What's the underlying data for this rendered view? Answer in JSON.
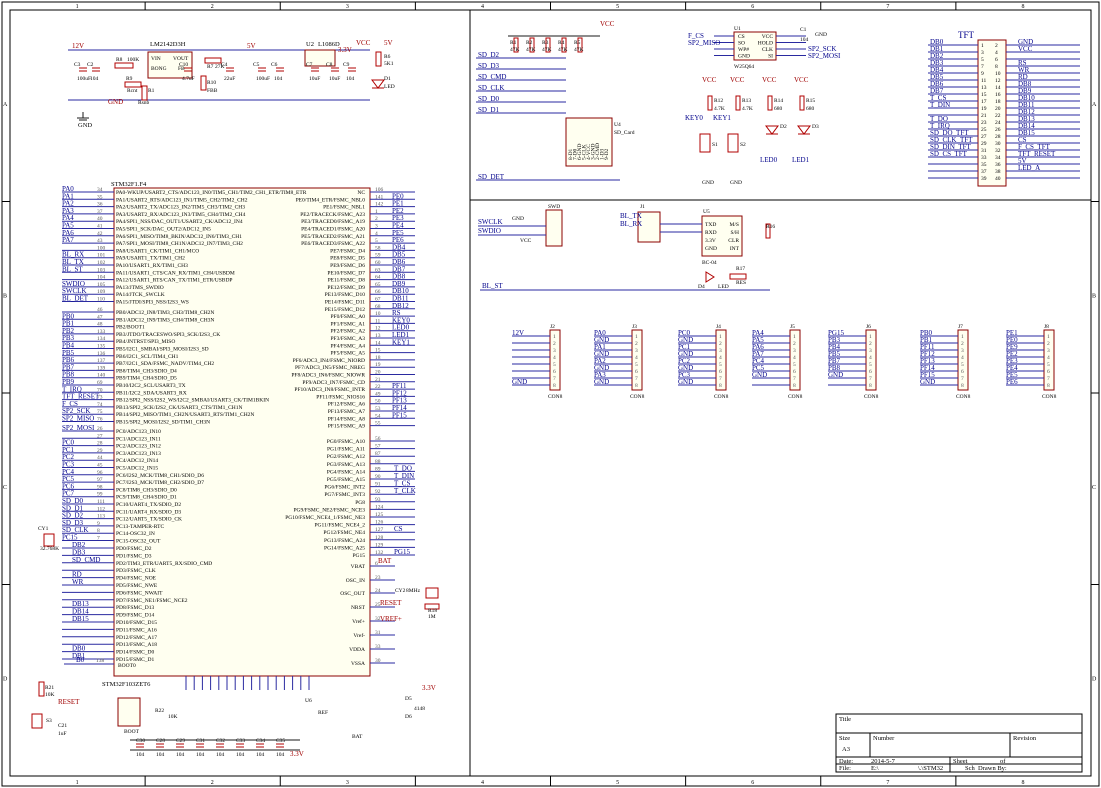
{
  "frame": {
    "cols": [
      "1",
      "2",
      "3",
      "4",
      "5",
      "6",
      "7",
      "8"
    ],
    "rows": [
      "A",
      "B",
      "C",
      "D"
    ]
  },
  "power": {
    "in12v": "12V",
    "v5": "5V",
    "v33": "3.3V",
    "vcc": "VCC",
    "gnd": "GND",
    "regulator": "LM2142D3H",
    "reg_pins": [
      "VIN",
      "VOUT",
      "BONG",
      "FB"
    ],
    "ldo": "L1086D",
    "ldo_label": "U2",
    "c_labels": [
      "C3",
      "C2",
      "C10",
      "C4",
      "C5",
      "C6",
      "C7",
      "C8",
      "C9"
    ],
    "c_values": [
      "100uF",
      "104",
      "4.7uF",
      "22uF",
      "100uF",
      "104",
      "10uF",
      "10uF",
      "104"
    ],
    "r_labels": [
      "R8",
      "R9",
      "R7",
      "R10",
      "R1",
      "R6"
    ],
    "r_values": [
      "100K",
      "Rcnt",
      "Rsnb",
      "27K",
      "FBB",
      "5K1"
    ],
    "u1": "U1",
    "d1": "D1",
    "led": "LED"
  },
  "mcu": {
    "name": "STM32F1.F4",
    "ref": "STM32F103ZET6",
    "left_nets": [
      "PA0",
      "PA1",
      "PA2",
      "PA3",
      "PA4",
      "PA5",
      "PA6",
      "PA7",
      "",
      "BL_RX",
      "BL_TX",
      "BL_ST",
      "",
      "SWDIO",
      "SWCLK",
      "BL_DET",
      "",
      "PB0",
      "PB1",
      "PB2",
      "PB3",
      "PB4",
      "PB5",
      "PB6",
      "PB7",
      "PB8",
      "PB9",
      "T_IRQ",
      "TFT_RESET",
      "F_CS",
      "SP2_SCK",
      "SP2_MISO",
      "SP2_MOSI",
      "",
      "PC0",
      "PC1",
      "PC2",
      "PC3",
      "PC4",
      "PC5",
      "PC6",
      "PC7",
      "SD_D0",
      "SD_D1",
      "SD_D2",
      "SD_D3",
      "SD_CLK",
      "PC15"
    ],
    "left_pins": [
      "34",
      "35",
      "36",
      "37",
      "40",
      "41",
      "42",
      "43",
      "100",
      "101",
      "102",
      "103",
      "104",
      "105",
      "109",
      "110",
      "46",
      "47",
      "48",
      "133",
      "134",
      "135",
      "136",
      "137",
      "139",
      "140",
      "69",
      "70",
      "73",
      "74",
      "75",
      "76",
      "26",
      "27",
      "28",
      "29",
      "44",
      "45",
      "96",
      "97",
      "98",
      "99",
      "111",
      "112",
      "113",
      "9",
      "8",
      "7"
    ],
    "left_fn": [
      "PA0-WKUP/USART2_CTS/ADC123_IN0/TIM5_CH1/TIM2_CH1_ETR/TIM8_ETR",
      "PA1/USART2_RTS/ADC123_IN1/TIM5_CH2/TIM2_CH2",
      "PA2/USART2_TX/ADC123_IN2/TIM5_CH3/TIM2_CH3",
      "PA3/USART2_RX/ADC123_IN3/TIM5_CH4/TIM2_CH4",
      "PA4/SPI1_NSS/DAC_OUT1/USART2_CK/ADC12_IN4",
      "PA5/SPI1_SCK/DAC_OUT2/ADC12_IN5",
      "PA6/SPI1_MISO/TIM8_BKIN/ADC12_IN6/TIM3_CH1",
      "PA7/SPI1_MOSI/TIM8_CH1N/ADC12_IN7/TIM3_CH2",
      "PA8/USART1_CK/TIM1_CH1/MCO",
      "PA9/USART1_TX/TIM1_CH2",
      "PA10/USART1_RX/TIM1_CH3",
      "PA11/USART1_CTS/CAN_RX/TIM1_CH4/USBDM",
      "PA12/USART1_RTS/CAN_TX/TIM1_ETR/USBDP",
      "PA13/JTMS_SWDIO",
      "PA14/JTCK_SWCLK",
      "PA15/JTDI/SPI3_NSS/I2S3_WS",
      "PB0/ADC12_IN8/TIM3_CH3/TIM8_CH2N",
      "PB1/ADC12_IN9/TIM3_CH4/TIM8_CH3N",
      "PB2/BOOT1",
      "PB3/JTDO/TRACESWO/SPI3_SCK/I2S3_CK",
      "PB4/JNTRST/SPI3_MISO",
      "PB5/I2C1_SMBAI/SPI3_MOSI/I2S3_SD",
      "PB6/I2C1_SCL/TIM4_CH1",
      "PB7/I2C1_SDA/FSMC_NADV/TIM4_CH2",
      "PB8/TIM4_CH3/SDIO_D4",
      "PB9/TIM4_CH4/SDIO_D5",
      "PB10/I2C2_SCL/USART3_TX",
      "PB11/I2C2_SDA/USART3_RX",
      "PB12/SPI2_NSS/I2S2_WS/I2C2_SMBAI/USART3_CK/TIM1BKIN",
      "PB13/SPI2_SCK/I2S2_CK/USART3_CTS/TIM1_CH1N",
      "PB14/SPI2_MISO/TIM1_CH2N/USART3_RTS/TIM1_CH2N",
      "PB15/SPI2_MOSI/I2S2_SD/TIM1_CH3N",
      "PC0/ADC123_IN10",
      "PC1/ADC123_IN11",
      "PC2/ADC123_IN12",
      "PC3/ADC123_IN13",
      "PC4/ADC12_IN14",
      "PC5/ADC12_IN15",
      "PC6/I2S2_MCK/TIM8_CH1/SDIO_D6",
      "PC7/I2S3_MCK/TIM8_CH2/SDIO_D7",
      "PC8/TIM8_CH3/SDIO_D0",
      "PC9/TIM8_CH4/SDIO_D1",
      "PC10/UART4_TX/SDIO_D2",
      "PC11/UART4_RX/SDIO_D3",
      "PC12/UART5_TX/SDIO_CK",
      "PC13-TAMPER-RTC",
      "PC14-OSC32_IN",
      "PC15-OSC32_OUT"
    ],
    "right_fn": [
      "NC",
      "PE0/TIM4_ETR/FSMC_NBL0",
      "PE1/FSMC_NBL1",
      "PE2/TRACECK/FSMC_A23",
      "PE3/TRACED0/FSMC_A19",
      "PE4/TRACED1/FSMC_A20",
      "PE5/TRACED2/FSMC_A21",
      "PE6/TRACED3/FSMC_A22",
      "PE7/FSMC_D4",
      "PE8/FSMC_D5",
      "PE9/FSMC_D6",
      "PE10/FSMC_D7",
      "PE11/FSMC_D8",
      "PE12/FSMC_D9",
      "PE13/FSMC_D10",
      "PE14/FSMC_D11",
      "PE15/FSMC_D12",
      "PF0/FSMC_A0",
      "PF1/FSMC_A1",
      "PF2/FSMC_A2",
      "PF3/FSMC_A3",
      "PF4/FSMC_A4",
      "PF5/FSMC_A5",
      "PF6/ADC3_IN4/FSMC_NIORD",
      "PF7/ADC3_IN5/FSMC_NREG",
      "PF8/ADC3_IN6/FSMC_NIOWR",
      "PF9/ADC3_IN7/FSMC_CD",
      "PF10/ADC3_IN8/FSMC_INTR",
      "PF11/FSMC_NIOS16",
      "PF12/FSMC_A6",
      "PF13/FSMC_A7",
      "PF14/FSMC_A8",
      "PF15/FSMC_A9"
    ],
    "right_pins": [
      "106",
      "141",
      "142",
      "1",
      "2",
      "3",
      "4",
      "5",
      "58",
      "59",
      "60",
      "63",
      "64",
      "65",
      "66",
      "67",
      "68",
      "10",
      "11",
      "12",
      "13",
      "14",
      "15",
      "18",
      "19",
      "20",
      "21",
      "22",
      "49",
      "50",
      "53",
      "54",
      "55"
    ],
    "right_nets": [
      "",
      "PE0",
      "PE1",
      "PE2",
      "PE3",
      "PE4",
      "PE5",
      "PE6",
      "DB4",
      "DB5",
      "DB6",
      "DB7",
      "DB8",
      "DB9",
      "DB10",
      "DB11",
      "DB12",
      "RS",
      "KEY0",
      "LED0",
      "LED1",
      "KEY1",
      "",
      "",
      "",
      "",
      "",
      "PF11",
      "PF12",
      "PF13",
      "PF14",
      "PF15",
      ""
    ],
    "g_fn": [
      "PG0/FSMC_A10",
      "PG1/FSMC_A11",
      "PG2/FSMC_A12",
      "PG3/FSMC_A13",
      "PG4/FSMC_A14",
      "PG5/FSMC_A15",
      "PG6/FSMC_INT2",
      "PG7/FSMC_INT3",
      "PG8",
      "PG9/FSMC_NE2/FSMC_NCE3",
      "PG10/FSMC_NCE4_1/FSMC_NE3",
      "PG11/FSMC_NCE4_2",
      "PG12/FSMC_NE4",
      "PG13/FSMC_A24",
      "PG14/FSMC_A25",
      "PG15"
    ],
    "g_pins": [
      "56",
      "57",
      "87",
      "88",
      "89",
      "90",
      "91",
      "92",
      "93",
      "124",
      "125",
      "126",
      "127",
      "128",
      "129",
      "132"
    ],
    "g_nets": [
      "",
      "",
      "",
      "",
      "T_DO",
      "T_DIN",
      "T_CS",
      "T_CLK",
      "",
      "",
      "",
      "",
      "CS",
      "",
      "",
      "PG15"
    ],
    "d_fn": [
      "PD0/FSMC_D2",
      "PD1/FSMC_D3",
      "PD2/TIM3_ETR/UART5_RX/SDIO_CMD",
      "PD3/FSMC_CLK",
      "PD4/FSMC_NOE",
      "PD5/FSMC_NWE",
      "PD6/FSMC_NWAIT",
      "PD7/FSMC_NE1/FSMC_NCE2",
      "PD8/FSMC_D13",
      "PD9/FSMC_D14",
      "PD10/FSMC_D15",
      "PD11/FSMC_A16",
      "PD12/FSMC_A17",
      "PD13/FSMC_A18",
      "PD14/FSMC_D0",
      "PD15/FSMC_D1"
    ],
    "d_nets": [
      "DB2",
      "DB3",
      "SD_CMD",
      "",
      "RD",
      "WR",
      "",
      "",
      "DB13",
      "DB14",
      "DB15",
      "",
      "",
      "",
      "DB0",
      "DB1"
    ],
    "misc_right": [
      "VBAT",
      "OSC_IN",
      "OSC_OUT",
      "NRST",
      "Vref+",
      "Vref-",
      "VDDA",
      "VSSA"
    ],
    "misc_pins": [
      "6",
      "23",
      "24",
      "25",
      "32",
      "31",
      "33",
      "30"
    ],
    "boot": "BOOT0",
    "boot_pin": "138",
    "bat": "BAT",
    "reset": "RESET",
    "vref": "VREF+",
    "b0": "B0"
  },
  "sd": {
    "nets": [
      "SD_D2",
      "SD_D3",
      "SD_CMD",
      "SD_CLK",
      "SD_D0",
      "SD_D1",
      "SD_DET"
    ],
    "res": [
      "R1",
      "R2",
      "R3",
      "R4",
      "R5"
    ],
    "res_val": [
      "47K",
      "47K",
      "47K",
      "47K",
      "47K"
    ],
    "conn": "U4",
    "conn_name": "SD_Card",
    "pins": [
      "8-D1",
      "7-D0",
      "6-GND",
      "5-CLK",
      "4-VCC",
      "3-GND",
      "2-CMD",
      "1-D3",
      "9-D2"
    ]
  },
  "flash": {
    "ref": "U1",
    "part": "W25Q64",
    "left": [
      "CS",
      "SO",
      "WP#",
      "GND"
    ],
    "right": [
      "VCC",
      "HOLD",
      "CLK",
      "SI"
    ],
    "nets_l": [
      "F_CS",
      "SP2_MISO"
    ],
    "nets_r": [
      "SP2_SCK",
      "SP2_MOSI"
    ],
    "c": "C1",
    "cval": "104"
  },
  "keys": {
    "r": [
      "R12",
      "R13",
      "R14",
      "R15"
    ],
    "rval": [
      "4.7K",
      "4.7K",
      "680",
      "680"
    ],
    "names": [
      "KEY0",
      "KEY1"
    ],
    "sw": [
      "S1",
      "S2"
    ],
    "leds": [
      "D2",
      "D3"
    ],
    "led_nets": [
      "LED0",
      "LED1"
    ]
  },
  "tft": {
    "title": "TFT",
    "left": [
      "DB0",
      "DB1",
      "DB2",
      "DB3",
      "DB4",
      "DB5",
      "DB6",
      "DB7",
      "T_CS",
      "T_DIN",
      "",
      "T_DO",
      "T_IRQ",
      "SD_DO_TFT",
      "SD_CLK_TFT",
      "SD_DIN_TFT",
      "SD_CS_TFT",
      ""
    ],
    "right": [
      "GND",
      "VCC",
      "",
      "RS",
      "WR",
      "RD",
      "DB8",
      "DB9",
      "DB10",
      "DB11",
      "DB12",
      "DB13",
      "DB14",
      "DB15",
      "CS",
      "F_CS_TFT",
      "TFT_RESET",
      "5V",
      "LED_A"
    ],
    "pins_l": [
      "1",
      "3",
      "5",
      "7",
      "9",
      "11",
      "13",
      "15",
      "17",
      "19",
      "21",
      "23",
      "25",
      "27",
      "29",
      "31",
      "33",
      "35",
      "37",
      "39"
    ],
    "pins_r": [
      "2",
      "4",
      "6",
      "8",
      "10",
      "12",
      "14",
      "16",
      "18",
      "20",
      "22",
      "24",
      "26",
      "28",
      "30",
      "32",
      "34",
      "36",
      "38",
      "40"
    ]
  },
  "usb": {
    "swd": "SWD",
    "swd_nets": [
      "SWCLK",
      "SWDIO"
    ],
    "j1": "J1",
    "j1_nets": [
      "BL_TX",
      "BL_RX"
    ],
    "u5": "U5",
    "u5_l": [
      "TXD",
      "RXD",
      "3.3V",
      "GND"
    ],
    "u5_r": [
      "M/S",
      "S/H",
      "CLR",
      "INT"
    ],
    "part": "BC-04",
    "r16": "R16",
    "r17": "R17",
    "r17v": "RES",
    "d4": "D4",
    "led": "LED",
    "bl_st": "BL_ST"
  },
  "headers": [
    {
      "ref": "J2",
      "name": "CON8",
      "nets": [
        "12V",
        "",
        "",
        "",
        "",
        "",
        "",
        "GND"
      ]
    },
    {
      "ref": "J3",
      "name": "CON8",
      "nets": [
        "PA0",
        "GND",
        "PA1",
        "GND",
        "PA2",
        "GND",
        "PA3",
        "GND"
      ]
    },
    {
      "ref": "J4",
      "name": "CON8",
      "nets": [
        "PC0",
        "GND",
        "PC1",
        "GND",
        "PC2",
        "GND",
        "PC3",
        "GND"
      ]
    },
    {
      "ref": "J5",
      "name": "CON8",
      "nets": [
        "PA4",
        "PA5",
        "PA6",
        "PA7",
        "PC4",
        "PC5",
        "GND",
        ""
      ]
    },
    {
      "ref": "J6",
      "name": "CON8",
      "nets": [
        "PG15",
        "PB3",
        "PB4",
        "PB5",
        "PB7",
        "PB8",
        "GND",
        ""
      ]
    },
    {
      "ref": "J7",
      "name": "CON8",
      "nets": [
        "PB0",
        "PB1",
        "PF11",
        "PF12",
        "PF13",
        "PF14",
        "PF15",
        "GND"
      ]
    },
    {
      "ref": "J8",
      "name": "CON8",
      "nets": [
        "PE1",
        "PE0",
        "PE9",
        "PE2",
        "PE3",
        "PE4",
        "PE5",
        "PE6"
      ]
    }
  ],
  "bottom": {
    "crystal": "CY1",
    "crystal_val": "32.768K",
    "cy2": "CY2",
    "cy2_val": "8MHz",
    "r18": "R18",
    "r18v": "1M",
    "c21": "C21",
    "c21v": "1uF",
    "r21": "R21",
    "r21v": "10K",
    "s3": "S3",
    "boot": "BOOT",
    "r22": "R22",
    "r22v": "10K",
    "r24": "R24",
    "u6": "U6",
    "ref_label": "REF",
    "bat_label": "BAT",
    "d5": "D5",
    "d6": "D6",
    "d_val": "4148",
    "caps": [
      "C30",
      "C28",
      "C29",
      "C31",
      "C32",
      "C33",
      "C34",
      "C35"
    ],
    "cap_vals": [
      "104",
      "104",
      "104",
      "104",
      "104",
      "104",
      "104",
      "104"
    ],
    "cap_row_labels": [
      "3.3V"
    ]
  },
  "title_block": {
    "title_label": "Title",
    "size_label": "Size",
    "size": "A3",
    "number_label": "Number",
    "revision_label": "Revision",
    "date_label": "Date:",
    "date": "2014-5-7",
    "sheet_label": "Sheet",
    "of_label": "of",
    "file_label": "File:",
    "file": "E:\\",
    "file2": "\\.\\STM32",
    "sch_label": "Sch",
    "drawn_label": "Drawn By:"
  }
}
